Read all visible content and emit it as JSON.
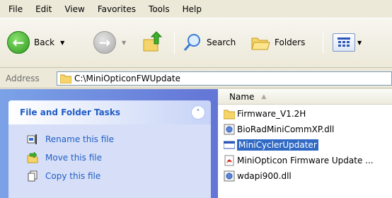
{
  "menu": [
    "File",
    "Edit",
    "View",
    "Favorites",
    "Tools",
    "Help"
  ],
  "toolbar": {
    "back_label": "Back",
    "search_label": "Search",
    "folders_label": "Folders"
  },
  "address": {
    "label": "Address",
    "path": "C:\\MiniOpticonFWUpdate"
  },
  "tasks": {
    "header": "File and Folder Tasks",
    "items": [
      {
        "label": "Rename this file",
        "icon": "rename-icon"
      },
      {
        "label": "Move this file",
        "icon": "move-icon"
      },
      {
        "label": "Copy this file",
        "icon": "copy-icon"
      }
    ]
  },
  "filelist": {
    "column_name": "Name",
    "files": [
      {
        "name": "Firmware_V1.2H",
        "icon": "folder-icon",
        "selected": false
      },
      {
        "name": "BioRadMiniCommXP.dll",
        "icon": "dll-icon",
        "selected": false
      },
      {
        "name": "MiniCyclerUpdater",
        "icon": "application-icon",
        "selected": true
      },
      {
        "name": "MiniOpticon Firmware Update ...",
        "icon": "pdf-icon",
        "selected": false
      },
      {
        "name": "wdapi900.dll",
        "icon": "dll-icon",
        "selected": false
      }
    ]
  },
  "colors": {
    "task_link": "#215dc6",
    "selection": "#316ac5",
    "left_pane": "#7ba2e7"
  }
}
